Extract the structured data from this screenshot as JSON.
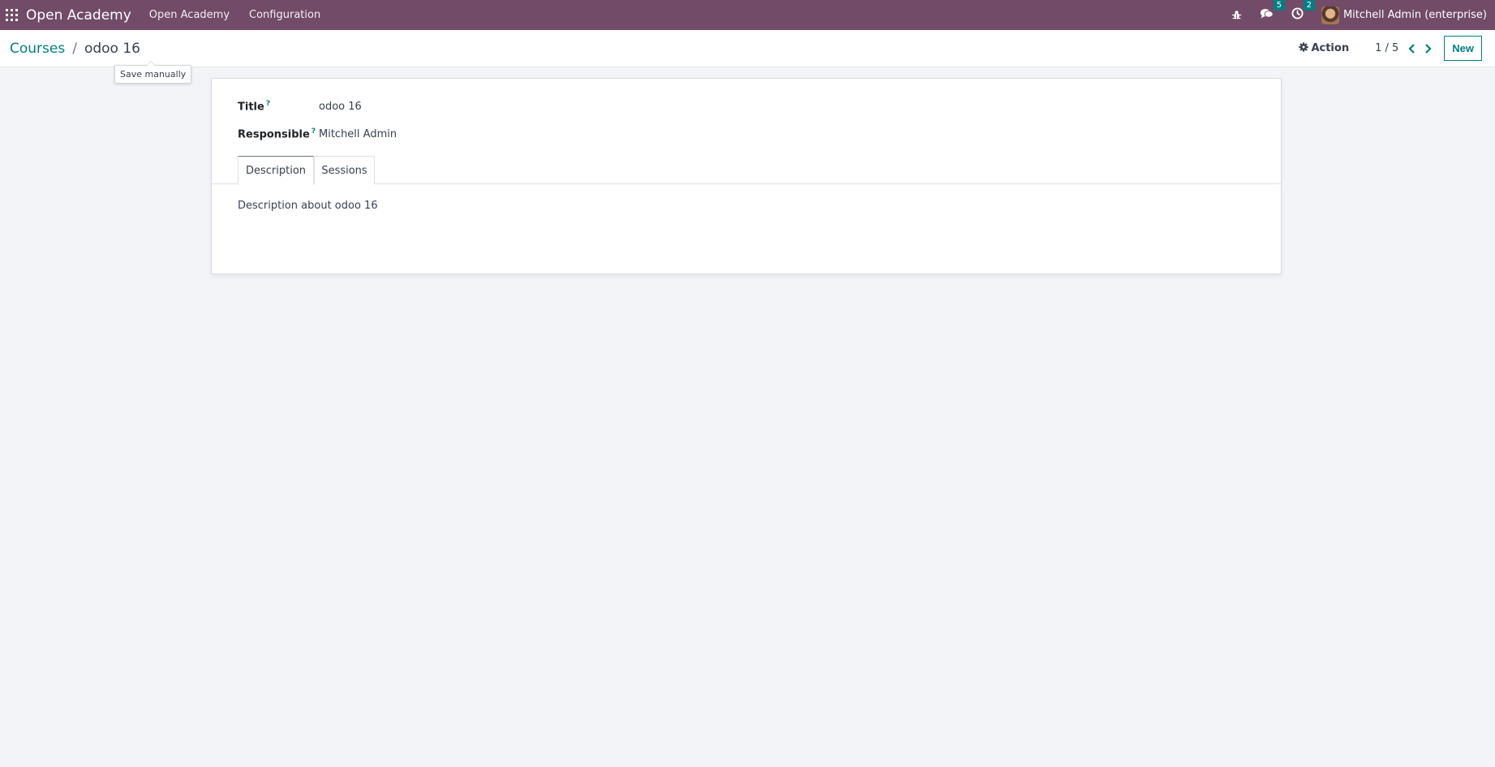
{
  "navbar": {
    "brand": "Open Academy",
    "menu": [
      "Open Academy",
      "Configuration"
    ],
    "messages_count": "5",
    "activities_count": "2",
    "user_name": "Mitchell Admin (enterprise)",
    "bar_color": "#714b67",
    "accent_color": "#017e84"
  },
  "control": {
    "breadcrumb_parent": "Courses",
    "breadcrumb_separator": "/",
    "breadcrumb_current": "odoo 16",
    "tooltip": "Save manually",
    "action_label": "Action",
    "pager": "1 / 5",
    "new_label": "New"
  },
  "form": {
    "title_label": "Title",
    "title_help": "?",
    "title_value": "odoo 16",
    "responsible_label": "Responsible",
    "responsible_help": "?",
    "responsible_value": "Mitchell Admin",
    "tabs": [
      "Description",
      "Sessions"
    ],
    "active_tab": "Description",
    "description": "Description about odoo 16"
  },
  "icons": {
    "apps": "apps-grid-icon",
    "debug": "bug-icon",
    "messages": "chat-icon",
    "activities": "clock-icon",
    "action": "gear-icon",
    "prev": "chevron-left-icon",
    "next": "chevron-right-icon"
  }
}
